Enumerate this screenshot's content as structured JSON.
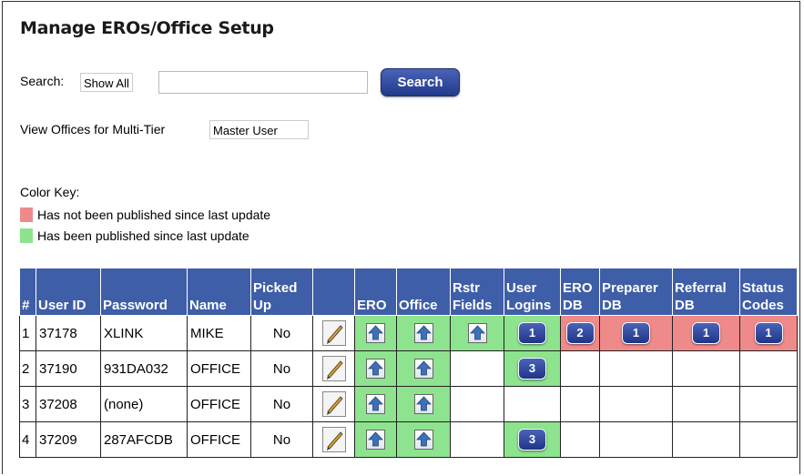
{
  "page": {
    "title": "Manage EROs/Office Setup",
    "search_label": "Search:",
    "search_scope": "Show All",
    "search_value": "",
    "search_button": "Search",
    "multitier_label": "View Offices for Multi-Tier",
    "multitier_value": "Master User"
  },
  "color_key": {
    "title": "Color Key:",
    "items": [
      {
        "label": "Has not been published since last update",
        "color": "#ef8a8a"
      },
      {
        "label": "Has been published since last update",
        "color": "#8ee38e"
      }
    ]
  },
  "table": {
    "headers": {
      "num": "#",
      "user_id": "User ID",
      "password": "Password",
      "name": "Name",
      "picked_up_1": "Picked",
      "picked_up_2": "Up",
      "edit": "",
      "ero": "ERO",
      "office": "Office",
      "rstr_1": "Rstr",
      "rstr_2": "Fields",
      "logins_1": "User",
      "logins_2": "Logins",
      "erodb_1": "ERO",
      "erodb_2": "DB",
      "prepdb_1": "Preparer",
      "prepdb_2": "DB",
      "refdb_1": "Referral",
      "refdb_2": "DB",
      "status_1": "Status",
      "status_2": "Codes"
    },
    "rows": [
      {
        "num": "1",
        "user_id": "37178",
        "password": "XLINK",
        "name": "MIKE",
        "picked_up": "No",
        "user_logins": "1",
        "ero_db": "2",
        "preparer_db": "1",
        "referral_db": "1",
        "status_codes": "1"
      },
      {
        "num": "2",
        "user_id": "37190",
        "password": "931DA032",
        "name": "OFFICE",
        "picked_up": "No",
        "user_logins": "3"
      },
      {
        "num": "3",
        "user_id": "37208",
        "password": "(none)",
        "name": "OFFICE",
        "picked_up": "No"
      },
      {
        "num": "4",
        "user_id": "37209",
        "password": "287AFCDB",
        "name": "OFFICE",
        "picked_up": "No",
        "user_logins": "3"
      }
    ]
  },
  "icons": {
    "edit": "pencil-edit-icon",
    "publish": "upload-arrow-icon"
  },
  "colors": {
    "header_bg": "#3f5ea8",
    "button_blue": "#213a8a",
    "unpublished": "#ef8a8a",
    "published": "#8ee38e"
  }
}
